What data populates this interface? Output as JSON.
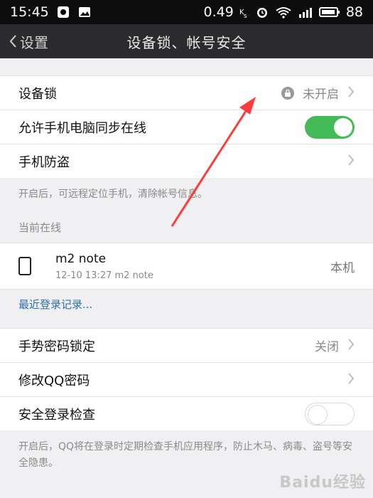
{
  "statusbar": {
    "time": "15:45",
    "network_speed": "0.49",
    "battery": "88"
  },
  "topbar": {
    "back_label": "设置",
    "title": "设备锁、帐号安全"
  },
  "rows": {
    "device_lock_label": "设备锁",
    "device_lock_status": "未开启",
    "sync_online_label": "允许手机电脑同步在线",
    "anti_theft_label": "手机防盗",
    "anti_theft_note": "开启后，可远程定位手机，清除帐号信息。"
  },
  "online": {
    "header": "当前在线",
    "device_name": "m2 note",
    "device_sub": "12-10 13:27 m2 note",
    "device_tag": "本机"
  },
  "recent": {
    "link": "最近登录记录..."
  },
  "security": {
    "gesture_label": "手势密码锁定",
    "gesture_status": "关闭",
    "change_pwd_label": "修改QQ密码",
    "safe_check_label": "安全登录检查",
    "safe_check_note": "开启后，QQ将在登录时定期检查手机应用程序，防止木马、病毒、盗号等安全隐患。"
  },
  "watermark": "Baidu经验",
  "colors": {
    "toggle_on": "#43bb57",
    "link": "#2d6fb0",
    "arrow": "#ff3b3b"
  }
}
